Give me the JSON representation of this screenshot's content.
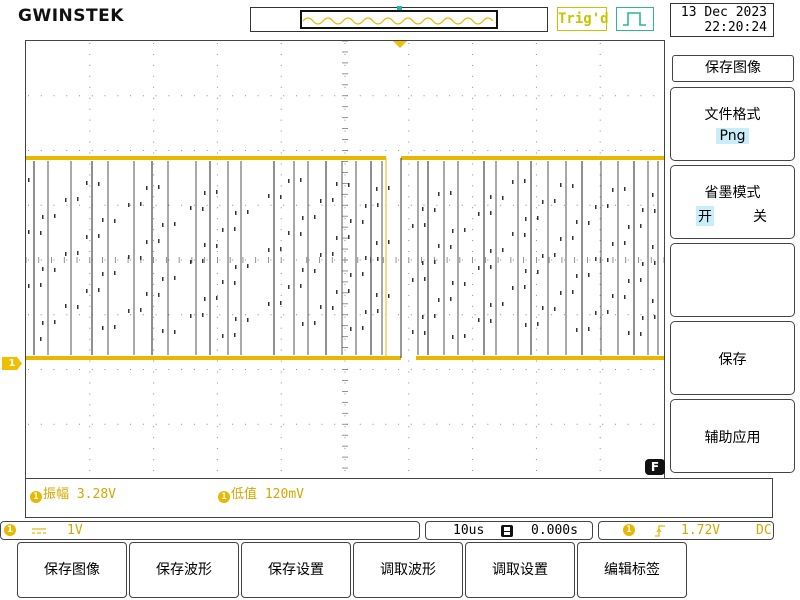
{
  "header": {
    "logo": "GWINSTEK",
    "trigger_status": "Trig'd",
    "date": "13 Dec 2023",
    "time": "22:20:24"
  },
  "colors": {
    "channel1": "#e8b800",
    "trigger_status": "#c9c400",
    "run_icon": "#2cb98c",
    "highlight": "#c9eef9"
  },
  "channel": {
    "marker": "1",
    "coupling_icon": "dc-coupling-icon",
    "scale": "1V"
  },
  "measurements": [
    {
      "icon": "1",
      "label": "振幅",
      "value": "3.28V"
    },
    {
      "icon": "1",
      "label": "低值",
      "value": "120mV"
    }
  ],
  "timebase": {
    "scale": "10us",
    "icon": "horizontal-position-icon",
    "position": "0.000s"
  },
  "trigger": {
    "source": "1",
    "slope_icon": "rising-edge-icon",
    "level": "1.72V",
    "coupling": "DC"
  },
  "side_menu": {
    "title": "保存图像",
    "file_format": {
      "label": "文件格式",
      "value": "Png"
    },
    "ink_saver": {
      "label": "省墨模式",
      "on": "开",
      "off": "关"
    },
    "empty": "",
    "save": "保存",
    "assist": "辅助应用"
  },
  "f_key": "F",
  "softkeys": [
    "保存图像",
    "保存波形",
    "保存设置",
    "调取波形",
    "调取设置",
    "编辑标签"
  ]
}
